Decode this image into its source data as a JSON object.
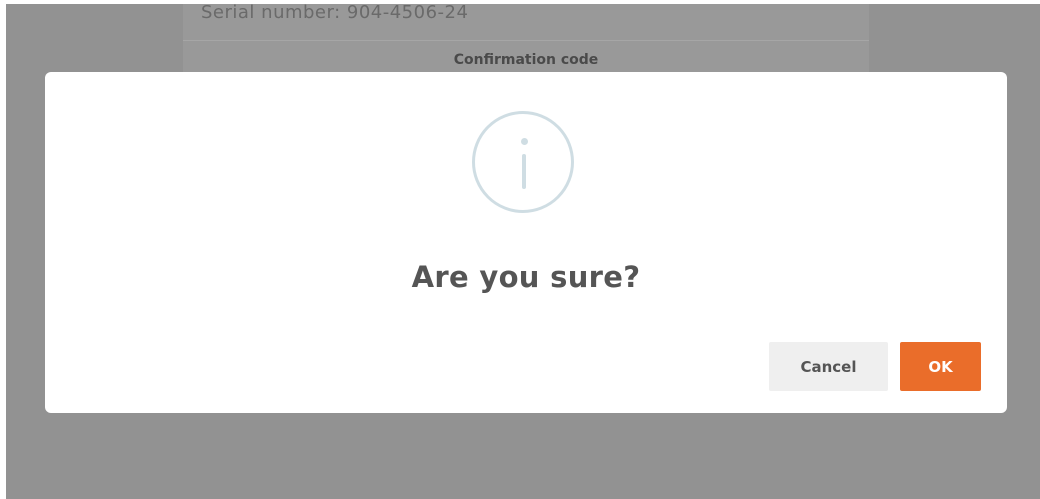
{
  "background_page": {
    "serial_text": "Serial number: 904-4506-24",
    "confirmation_label": "Confirmation code"
  },
  "modal": {
    "icon": "info-icon",
    "title": "Are you sure?",
    "cancel_label": "Cancel",
    "ok_label": "OK"
  },
  "colors": {
    "overlay": "#929292",
    "modal_bg": "#ffffff",
    "icon": "#cfdde3",
    "title": "#555555",
    "cancel_bg": "#efefef",
    "ok_bg": "#ea6d2a"
  }
}
